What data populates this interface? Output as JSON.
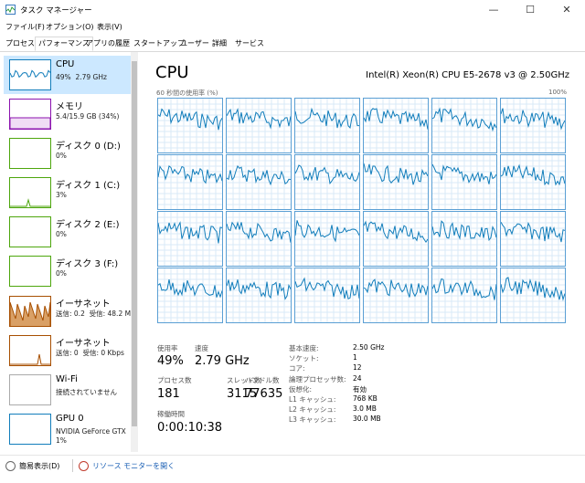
{
  "window": {
    "title": "タスク マネージャー",
    "min": "—",
    "max": "☐",
    "close": "✕"
  },
  "menu": [
    "ファイル(F)",
    "オプション(O)",
    "表示(V)"
  ],
  "tabs": [
    "プロセス",
    "パフォーマンス",
    "アプリの履歴",
    "スタートアップ",
    "ユーザー",
    "詳細",
    "サービス"
  ],
  "active_tab": 1,
  "sidebar": [
    {
      "title": "CPU",
      "sub": "49%  2.79 GHz",
      "color": "#117dbb",
      "icon": "cpu-graph-icon"
    },
    {
      "title": "メモリ",
      "sub": "5.4/15.9 GB (34%)",
      "color": "#8b12ae",
      "icon": "memory-graph-icon"
    },
    {
      "title": "ディスク 0 (D:)",
      "sub": "0%",
      "color": "#4da60c",
      "icon": "disk-graph-icon"
    },
    {
      "title": "ディスク 1 (C:)",
      "sub": "3%",
      "color": "#4da60c",
      "icon": "disk-graph-icon"
    },
    {
      "title": "ディスク 2 (E:)",
      "sub": "0%",
      "color": "#4da60c",
      "icon": "disk-graph-icon"
    },
    {
      "title": "ディスク 3 (F:)",
      "sub": "0%",
      "color": "#4da60c",
      "icon": "disk-graph-icon"
    },
    {
      "title": "イーサネット",
      "sub": "送信: 0.2  受信: 48.2 M",
      "color": "#a74f01",
      "icon": "ethernet-graph-icon"
    },
    {
      "title": "イーサネット",
      "sub": "送信: 0  受信: 0 Kbps",
      "color": "#a74f01",
      "icon": "ethernet-graph-icon"
    },
    {
      "title": "Wi-Fi",
      "sub": "接続されていません",
      "color": "#aaaaaa",
      "icon": "wifi-graph-icon"
    },
    {
      "title": "GPU 0",
      "sub": "NVIDIA GeForce GTX\n1%",
      "color": "#117dbb",
      "icon": "gpu-graph-icon"
    }
  ],
  "main": {
    "title": "CPU",
    "model": "Intel(R) Xeon(R) CPU E5-2678 v3 @ 2.50GHz",
    "graph_label": "60 秒間の使用率 (%)",
    "graph_max": "100%",
    "graph_color": "#117dbb",
    "logical_cores": 24,
    "stats": {
      "util_label": "使用率",
      "util_value": "49%",
      "speed_label": "速度",
      "speed_value": "2.79 GHz",
      "proc_label": "プロセス数",
      "proc_value": "181",
      "thread_label": "スレッド数",
      "thread_value": "3115",
      "handle_label": "ハンドル数",
      "handle_value": "77635",
      "uptime_label": "稼働時間",
      "uptime_value": "0:00:10:38"
    },
    "details": [
      {
        "k": "基本速度:",
        "v": "2.50 GHz"
      },
      {
        "k": "ソケット:",
        "v": "1"
      },
      {
        "k": "コア:",
        "v": "12"
      },
      {
        "k": "論理プロセッサ数:",
        "v": "24"
      },
      {
        "k": "仮想化:",
        "v": "有効"
      },
      {
        "k": "L1 キャッシュ:",
        "v": "768 KB"
      },
      {
        "k": "L2 キャッシュ:",
        "v": "3.0 MB"
      },
      {
        "k": "L3 キャッシュ:",
        "v": "30.0 MB"
      }
    ]
  },
  "footer": {
    "less": "簡易表示(D)",
    "monitor": "リソース モニターを開く"
  }
}
